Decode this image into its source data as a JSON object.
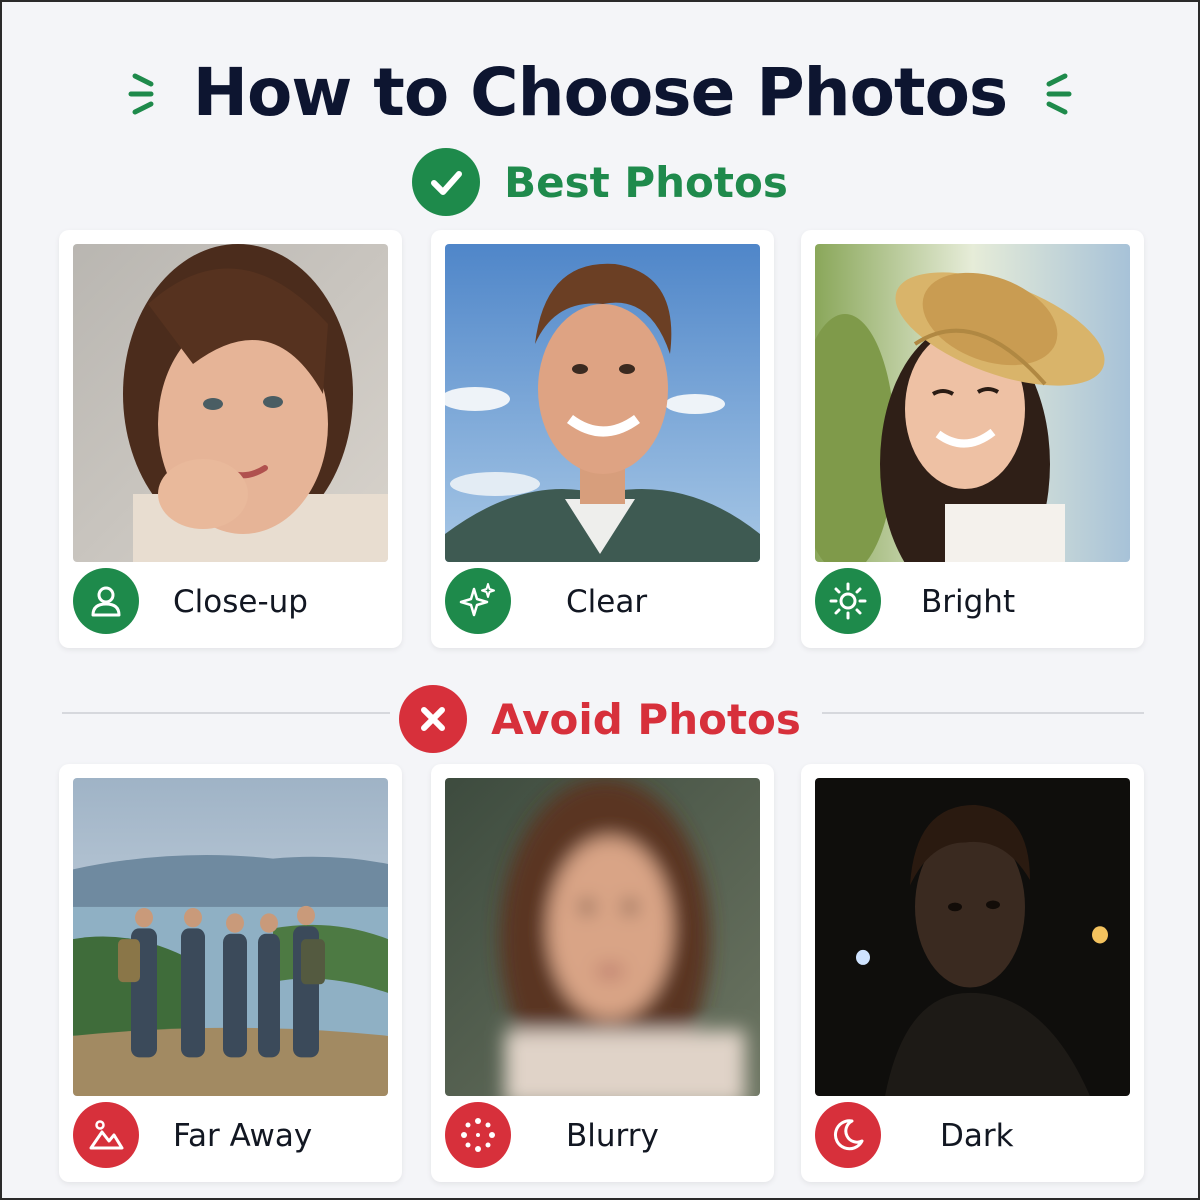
{
  "title": "How to Choose Photos",
  "colors": {
    "green": "#1e8a4b",
    "red": "#d7303b",
    "title": "#0d1530"
  },
  "best": {
    "heading": "Best Photos",
    "icon": "check-circle-icon",
    "cards": [
      {
        "label": "Close-up",
        "icon": "person-icon",
        "photo": "woman-closeup-portrait"
      },
      {
        "label": "Clear",
        "icon": "sparkles-icon",
        "photo": "man-smiling-blue-sky"
      },
      {
        "label": "Bright",
        "icon": "sun-icon",
        "photo": "woman-straw-hat-sunlight"
      }
    ]
  },
  "avoid": {
    "heading": "Avoid Photos",
    "icon": "x-circle-icon",
    "cards": [
      {
        "label": "Far Away",
        "icon": "landscape-icon",
        "photo": "group-hikers-far-away"
      },
      {
        "label": "Blurry",
        "icon": "blur-dots-icon",
        "photo": "blurry-woman-portrait"
      },
      {
        "label": "Dark",
        "icon": "moon-icon",
        "photo": "man-dark-night"
      }
    ]
  }
}
